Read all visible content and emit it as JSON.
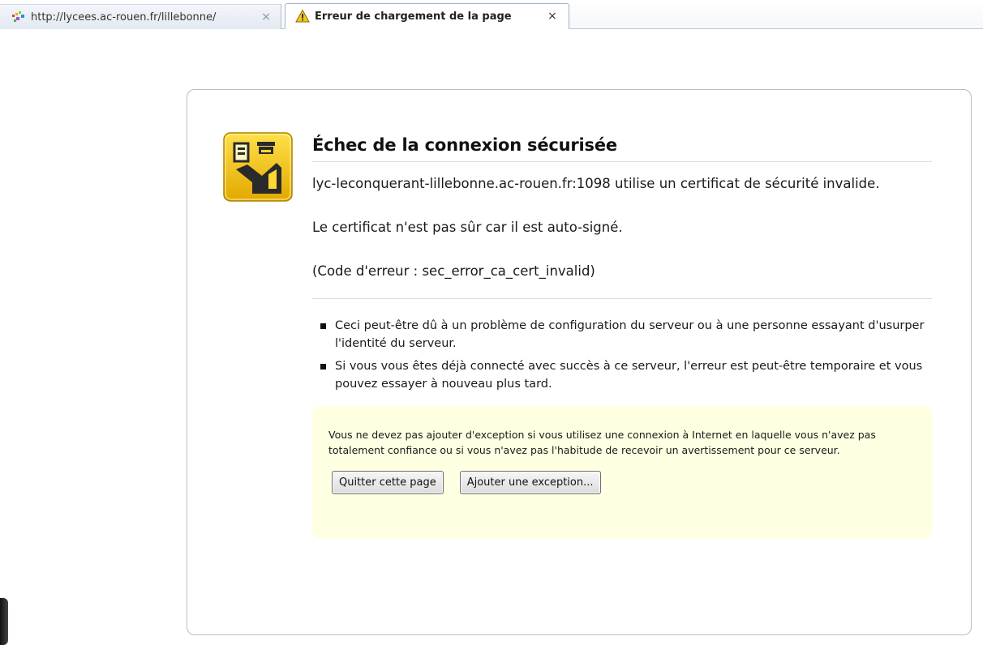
{
  "tabs": [
    {
      "title": "http://lycees.ac-rouen.fr/lillebonne/",
      "close": "×",
      "icon": "site-favicon",
      "active": false
    },
    {
      "title": "Erreur de chargement de la page",
      "close": "×",
      "icon": "warning-icon",
      "active": true
    }
  ],
  "error": {
    "icon": "certificate-officer-icon",
    "title": "Échec de la connexion sécurisée",
    "message": "lyc-leconquerant-lillebonne.ac-rouen.fr:1098 utilise un certificat de sécurité invalide.",
    "reason": "Le certificat n'est pas sûr car il est auto-signé.",
    "code": "(Code d'erreur : sec_error_ca_cert_invalid)",
    "bullets": [
      "Ceci peut-être dû à un problème de configuration du serveur ou à une personne essayant d'usurper l'identité du serveur.",
      "Si vous vous êtes déjà connecté avec succès à ce serveur, l'erreur est peut-être temporaire et vous pouvez essayer à nouveau plus tard."
    ],
    "warning": "Vous ne devez pas ajouter d'exception si vous utilisez une connexion à Internet en laquelle vous n'avez pas totalement confiance ou si vous n'avez pas l'habitude de recevoir un avertissement pour ce serveur.",
    "buttons": {
      "leave": "Quitter cette page",
      "add_exception": "Ajouter une exception..."
    }
  },
  "colors": {
    "warning_box_bg": "#ffffe2",
    "icon_yellow": "#f2c20a",
    "panel_border": "#bdbdbd"
  }
}
